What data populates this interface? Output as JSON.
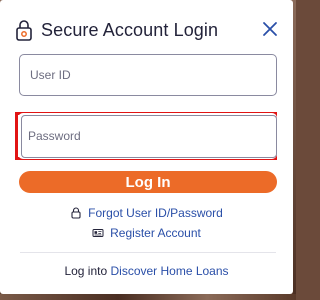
{
  "modal": {
    "title": "Secure Account Login",
    "icons": {
      "lock": "lock-icon",
      "close": "close-icon"
    }
  },
  "form": {
    "user_id": {
      "placeholder": "User ID",
      "value": ""
    },
    "password": {
      "placeholder": "Password",
      "value": ""
    },
    "login_label": "Log In"
  },
  "links": {
    "forgot": {
      "label": "Forgot User ID/Password",
      "icon": "lock-icon"
    },
    "register": {
      "label": "Register Account",
      "icon": "id-card-icon"
    }
  },
  "footer": {
    "prefix": "Log into",
    "link_label": "Discover Home Loans"
  },
  "colors": {
    "accent": "#ec6b28",
    "link": "#2a4fa8",
    "highlight": "#e11414",
    "text": "#23233a"
  }
}
